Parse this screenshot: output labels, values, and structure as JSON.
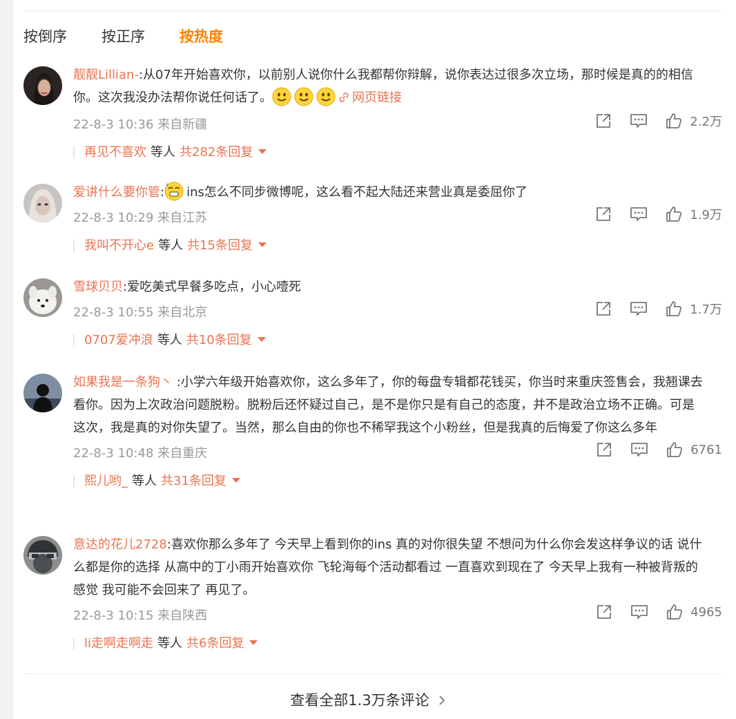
{
  "sort_tabs": {
    "reverse": "按倒序",
    "forward": "按正序",
    "hot": "按热度"
  },
  "comments": [
    {
      "username": "靓靓Lillian-",
      "text": ":从07年开始喜欢你，以前别人说你什么我都帮你辩解，说你表达过很多次立场，那时候是真的的相信你。这次我没办法帮你说任何话了。",
      "link_text": "网页链接",
      "meta": "22-8-3 10:36 来自新疆",
      "likes": "2.2万",
      "reply_user": "再见不喜欢",
      "reply_etc": "等人",
      "reply_count": "共282条回复"
    },
    {
      "username": "爱讲什么要你管",
      "text_prefix": ":",
      "text": "ins怎么不同步微博呢，这么看不起大陆还来营业真是委屈你了",
      "meta": "22-8-3 10:29 来自江苏",
      "likes": "1.9万",
      "reply_user": "我叫不开心e",
      "reply_etc": "等人",
      "reply_count": "共15条回复"
    },
    {
      "username": "雪球贝贝",
      "text": ":爱吃美式早餐多吃点，小心噎死",
      "meta": "22-8-3 10:55 来自北京",
      "likes": "1.7万",
      "reply_user": "0707爱冲浪",
      "reply_etc": "等人",
      "reply_count": "共10条回复"
    },
    {
      "username": "如果我是一条狗丶",
      "text": " :小学六年级开始喜欢你，这么多年了，你的每盘专辑都花钱买，你当时来重庆签售会，我翘课去看你。因为上次政治问题脱粉。脱粉后还怀疑过自己，是不是你只是有自己的态度，并不是政治立场不正确。可是这次，我是真的对你失望了。当然，那么自由的你也不稀罕我这个小粉丝，但是我真的后悔爱了你这么多年",
      "meta": "22-8-3 10:48 来自重庆",
      "likes": "6761",
      "reply_user": "熙儿哟_",
      "reply_etc": "等人",
      "reply_count": "共31条回复"
    },
    {
      "username": "意达的花儿2728",
      "text": ":喜欢你那么多年了 今天早上看到你的ins 真的对你很失望 不想问为什么你会发这样争议的话 说什么都是你的选择 从高中的丁小雨开始喜欢你 飞轮海每个活动都看过 一直喜欢到现在了 今天早上我有一种被背叛的感觉 我可能不会回来了 再见了。",
      "meta": "22-8-3 10:15 来自陕西",
      "likes": "4965",
      "reply_user": "li走啊走啊走",
      "reply_etc": "等人",
      "reply_count": "共6条回复"
    }
  ],
  "view_all": "查看全部1.3万条评论",
  "icons": {
    "share": "share-icon",
    "comment": "comment-icon",
    "like": "thumbs-up-icon",
    "smile": "smile-emoji-icon",
    "sweat": "sweat-emoji-icon",
    "link": "link-icon"
  },
  "colors": {
    "accent": "#ff8200",
    "username": "#eb7350",
    "meta": "#999999"
  }
}
